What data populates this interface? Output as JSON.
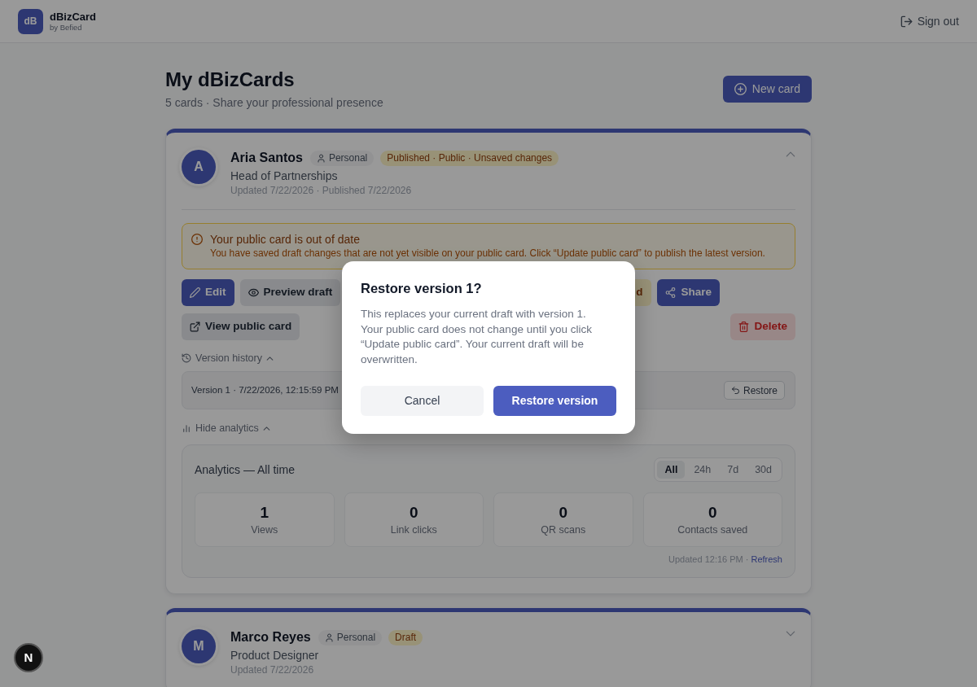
{
  "header": {
    "logo": "dB",
    "brand": "dBizCard",
    "byline": "by Befied",
    "sign_out": "Sign out"
  },
  "page": {
    "title": "My dBizCards",
    "subtitle": "5 cards · Share your professional presence",
    "new_card": "New card"
  },
  "cards": [
    {
      "initial": "A",
      "name": "Aria Santos",
      "expanded": true,
      "badges": [
        {
          "kind": "type",
          "label": "Personal"
        },
        {
          "kind": "status",
          "label": "Published · Public · Unsaved changes"
        }
      ],
      "role": "Head of Partnerships",
      "meta": "Updated 7/22/2026 · Published 7/22/2026",
      "alert": {
        "title": "Your public card is out of date",
        "text": "You have saved draft changes that are not yet visible on your public card. Click “Update public card” to publish the latest version."
      },
      "action_rows": [
        [
          {
            "kind": "edit",
            "label": "Edit"
          },
          {
            "kind": "preview",
            "label": "Preview draft"
          },
          {
            "kind": "update",
            "label": "d"
          },
          {
            "kind": "share",
            "label": "Share"
          }
        ],
        [
          {
            "kind": "public",
            "label": "View public card"
          },
          {
            "kind": "delete",
            "label": "Delete"
          }
        ]
      ],
      "version_history": {
        "label": "Version history",
        "expanded": true,
        "versions": [
          {
            "label": "Version 1 · 7/22/2026, 12:15:59 PM",
            "button": "Restore"
          }
        ]
      },
      "analytics": {
        "toggle": "Hide analytics",
        "expanded": true,
        "title": "Analytics — All time",
        "periods": [
          {
            "label": "All",
            "selected": true
          },
          {
            "label": "24h",
            "selected": false
          },
          {
            "label": "7d",
            "selected": false
          },
          {
            "label": "30d",
            "selected": false
          }
        ],
        "stats": [
          {
            "value": "1",
            "label": "Views"
          },
          {
            "value": "0",
            "label": "Link clicks"
          },
          {
            "value": "0",
            "label": "QR scans"
          },
          {
            "value": "0",
            "label": "Contacts saved"
          }
        ],
        "updated": "Updated 12:16 PM ·",
        "refresh": "Refresh"
      }
    },
    {
      "initial": "M",
      "name": "Marco Reyes",
      "expanded": false,
      "badges": [
        {
          "kind": "type",
          "label": "Personal"
        },
        {
          "kind": "status",
          "label": "Draft"
        }
      ],
      "role": "Product Designer",
      "meta": "Updated 7/22/2026"
    }
  ],
  "dialog": {
    "title": "Restore version 1?",
    "text": "This replaces your current draft with version 1. Your public card does not change until you click “Update public card”. Your current draft will be overwritten.",
    "buttons": [
      {
        "kind": "secondary",
        "label": "Cancel"
      },
      {
        "kind": "primary",
        "label": "Restore version"
      }
    ]
  },
  "dev_indicator": {
    "label": "N"
  }
}
